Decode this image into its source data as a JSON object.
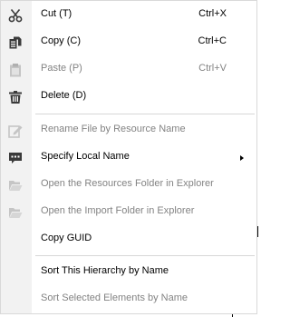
{
  "colors": {
    "text": "#000000",
    "disabled_text": "#838383",
    "gutter": "#f2f2f2",
    "icon_dark": "#3a3a3a",
    "icon_disabled": "#c5c5c5"
  },
  "menu": {
    "cut": {
      "label": "Cut (T)",
      "shortcut": "Ctrl+X",
      "icon": "scissors-icon"
    },
    "copy": {
      "label": "Copy (C)",
      "shortcut": "Ctrl+C",
      "icon": "copy-icon"
    },
    "paste": {
      "label": "Paste (P)",
      "shortcut": "Ctrl+V",
      "icon": "clipboard-icon",
      "disabled": true
    },
    "delete": {
      "label": "Delete (D)",
      "icon": "trash-icon"
    },
    "rename": {
      "label": "Rename File by Resource Name",
      "icon": "edit-icon",
      "disabled": true
    },
    "specify_local_name": {
      "label": "Specify Local Name",
      "icon": "comment-icon",
      "has_submenu": true
    },
    "open_resources": {
      "label": "Open the Resources Folder in Explorer",
      "icon": "folder-open-icon",
      "disabled": true
    },
    "open_import": {
      "label": "Open the Import Folder in Explorer",
      "icon": "folder-open-icon",
      "disabled": true
    },
    "copy_guid": {
      "label": "Copy GUID"
    },
    "sort_hierarchy": {
      "label": "Sort This Hierarchy by Name"
    },
    "sort_selected": {
      "label": "Sort Selected Elements by Name",
      "disabled": true
    }
  }
}
